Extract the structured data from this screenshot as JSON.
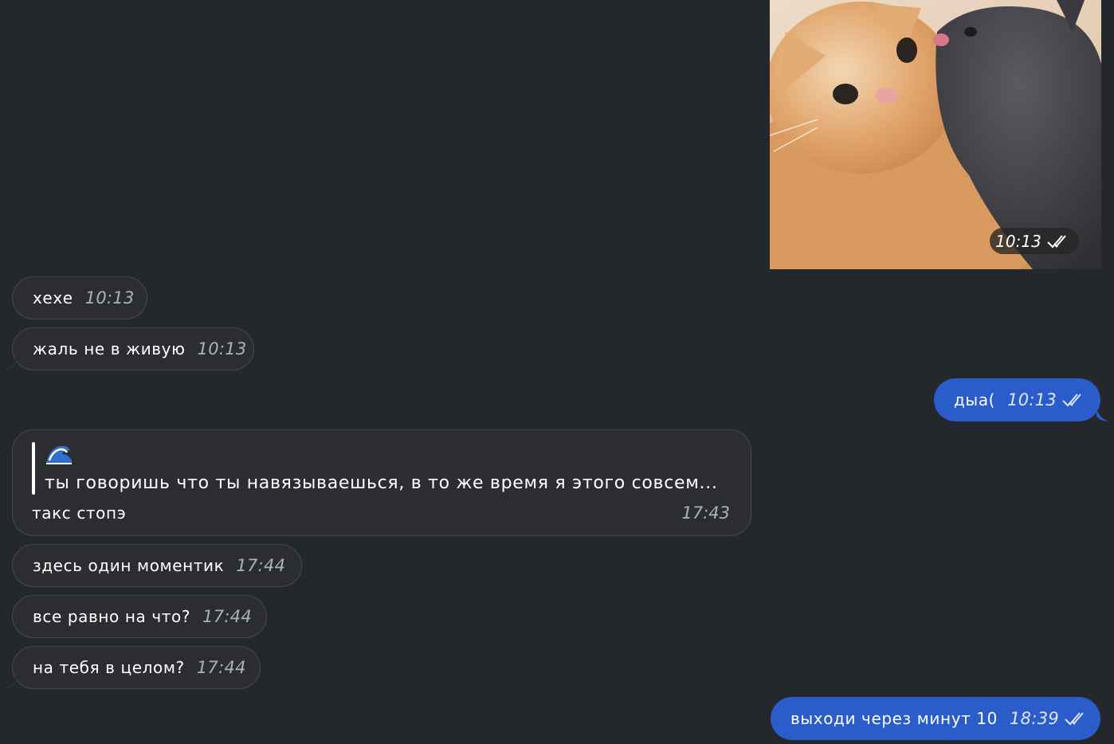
{
  "photo": {
    "time": "10:13",
    "check_icon": "double-check-icon",
    "description": "two cats cuddling"
  },
  "messages": [
    {
      "text": "хехе",
      "time": "10:13"
    },
    {
      "text": "жаль не в живую",
      "time": "10:13"
    },
    {
      "text": "дыа(",
      "time": "10:13"
    },
    {
      "text": "здесь один моментик",
      "time": "17:44"
    },
    {
      "text": "все равно на что?",
      "time": "17:44"
    },
    {
      "text": "на тебя в целом?",
      "time": "17:44"
    },
    {
      "text": "выходи через минут 10",
      "time": "18:39"
    }
  ],
  "reply": {
    "quote_icon": "wave-emoji-icon",
    "quote_text": "ты говоришь что ты навязываешься, в то же время я этого совсем...",
    "text": "такс стопэ",
    "time": "17:43"
  },
  "colors": {
    "background": "#24272b",
    "incoming_bubble": "#2b2d30",
    "outgoing_bubble": "#2a5dca"
  }
}
